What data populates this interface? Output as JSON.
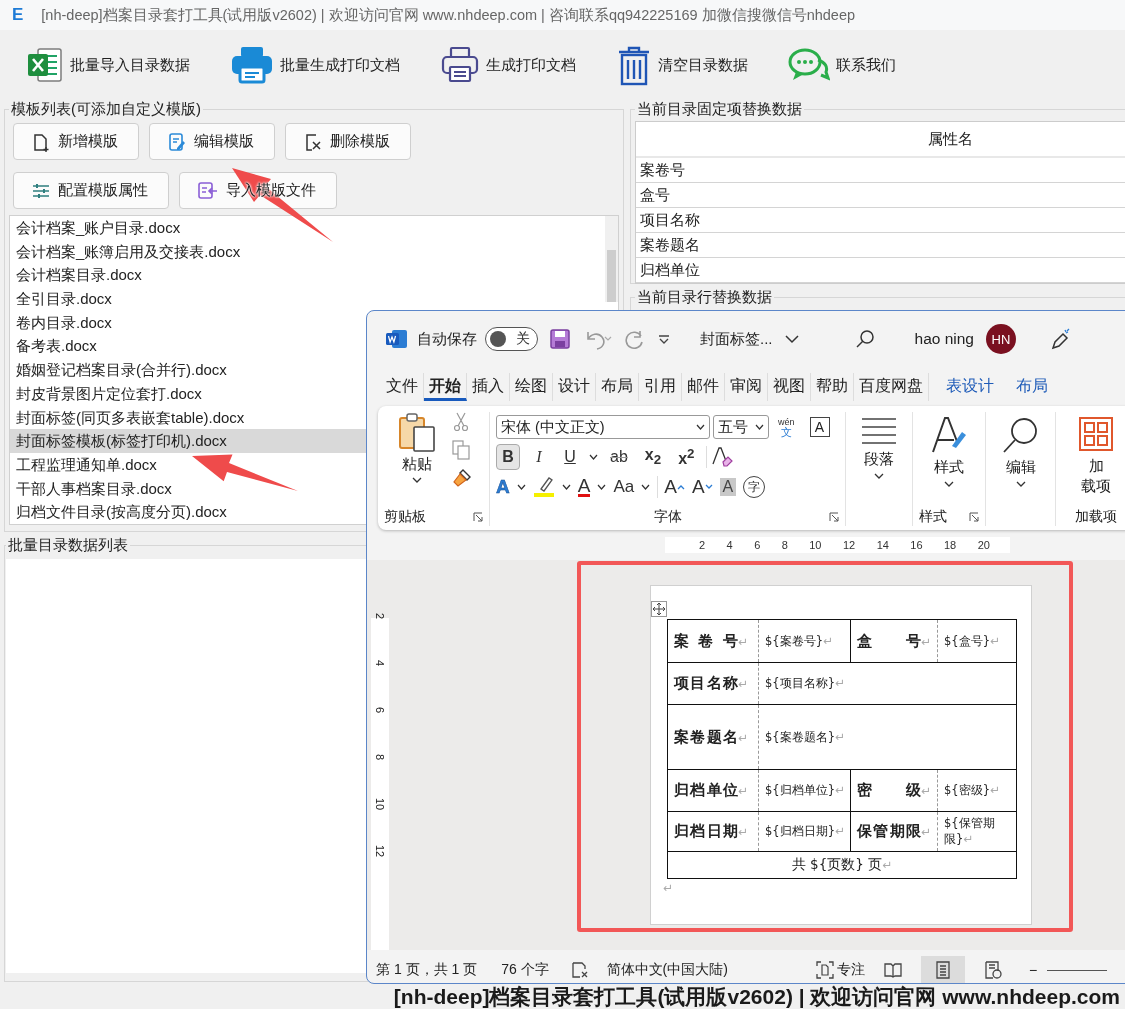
{
  "window": {
    "logo": "E",
    "title": "[nh-deep]档案目录套打工具(试用版v2602) | 欢迎访问官网 www.nhdeep.com | 咨询联系qq942225169 加微信搜微信号nhdeep"
  },
  "toolbar": [
    {
      "label": "批量导入目录数据"
    },
    {
      "label": "批量生成打印文档"
    },
    {
      "label": "生成打印文档"
    },
    {
      "label": "清空目录数据"
    },
    {
      "label": "联系我们"
    }
  ],
  "template_panel": {
    "title": "模板列表(可添加自定义模版)",
    "buttons": [
      {
        "label": "新增模版"
      },
      {
        "label": "编辑模版"
      },
      {
        "label": "删除模版"
      },
      {
        "label": "配置模版属性"
      },
      {
        "label": "导入模版文件"
      }
    ],
    "files": [
      {
        "name": "会计档案_账户目录.docx",
        "selected": false
      },
      {
        "name": "会计档案_账簿启用及交接表.docx",
        "selected": false
      },
      {
        "name": "会计档案目录.docx",
        "selected": false
      },
      {
        "name": "全引目录.docx",
        "selected": false
      },
      {
        "name": "卷内目录.docx",
        "selected": false
      },
      {
        "name": "备考表.docx",
        "selected": false
      },
      {
        "name": "婚姻登记档案目录(合并行).docx",
        "selected": false
      },
      {
        "name": "封皮背景图片定位套打.docx",
        "selected": false
      },
      {
        "name": "封面标签(同页多表嵌套table).docx",
        "selected": false
      },
      {
        "name": "封面标签模板(标签打印机).docx",
        "selected": true
      },
      {
        "name": "工程监理通知单.docx",
        "selected": false
      },
      {
        "name": "干部人事档案目录.docx",
        "selected": false
      },
      {
        "name": "归档文件目录(按高度分页).docx",
        "selected": false
      }
    ]
  },
  "batch_panel": {
    "title": "批量目录数据列表"
  },
  "fixed_panel": {
    "title": "当前目录固定项替换数据",
    "column": "属性名",
    "rows": [
      "案卷号",
      "盒号",
      "项目名称",
      "案卷题名",
      "归档单位"
    ]
  },
  "row_panel": {
    "title": "当前目录行替换数据"
  },
  "word": {
    "autosave": {
      "label": "自动保存",
      "on": false,
      "state_text": "关"
    },
    "doc_title": "封面标签...",
    "user": "hao ning",
    "avatar": "HN",
    "tabs": [
      {
        "label": "文件",
        "selected": false,
        "contextual": false
      },
      {
        "label": "开始",
        "selected": true,
        "contextual": false
      },
      {
        "label": "插入",
        "selected": false,
        "contextual": false
      },
      {
        "label": "绘图",
        "selected": false,
        "contextual": false
      },
      {
        "label": "设计",
        "selected": false,
        "contextual": false
      },
      {
        "label": "布局",
        "selected": false,
        "contextual": false
      },
      {
        "label": "引用",
        "selected": false,
        "contextual": false
      },
      {
        "label": "邮件",
        "selected": false,
        "contextual": false
      },
      {
        "label": "审阅",
        "selected": false,
        "contextual": false
      },
      {
        "label": "视图",
        "selected": false,
        "contextual": false
      },
      {
        "label": "帮助",
        "selected": false,
        "contextual": false
      },
      {
        "label": "百度网盘",
        "selected": false,
        "contextual": false
      },
      {
        "label": "表设计",
        "selected": false,
        "contextual": true
      },
      {
        "label": "布局",
        "selected": false,
        "contextual": true
      }
    ],
    "ribbon": {
      "paste": "粘贴",
      "font_name": "宋体 (中文正文)",
      "font_size": "五号",
      "phonetic": "wén",
      "phonetic_base": "文",
      "border_char": "A",
      "format": [
        {
          "kind": "bold",
          "label": "B",
          "selected": true
        },
        {
          "kind": "italic",
          "label": "I",
          "selected": false
        },
        {
          "kind": "underline",
          "label": "U",
          "selected": false
        },
        {
          "kind": "strike",
          "label": "ab",
          "selected": false
        },
        {
          "kind": "sub",
          "label": "x$_{2}$",
          "selected": false
        },
        {
          "kind": "sup",
          "label": "x$^{2}$",
          "selected": false
        }
      ],
      "effects": [
        {
          "kind": "effect",
          "label": "A"
        },
        {
          "kind": "highlight"
        },
        {
          "kind": "color",
          "label": "A"
        },
        {
          "kind": "case",
          "label": "Aa"
        },
        {
          "kind": "grow",
          "label": "A"
        },
        {
          "kind": "shrink",
          "label": "A"
        },
        {
          "kind": "shade",
          "label": "A"
        },
        {
          "kind": "enclose",
          "label": "字"
        }
      ],
      "clipboard_label": "剪贴板",
      "font_label": "字体",
      "paragraph": "段落",
      "styles": "样式",
      "styles_label": "样式",
      "editing": "编辑",
      "addins": [
        "加",
        "载项"
      ],
      "addins_label": "加载项"
    },
    "ruler": [
      "2",
      "4",
      "6",
      "8",
      "10",
      "12",
      "14",
      "16",
      "18",
      "20"
    ],
    "vruler": [
      "2",
      "4",
      "6",
      "8",
      "10",
      "12"
    ],
    "table": {
      "rows": [
        [
          {
            "kind": "label",
            "text": "案 卷 号",
            "mark": "↵"
          },
          {
            "kind": "value",
            "text": "${案卷号}",
            "mark": "↵"
          },
          {
            "kind": "label",
            "text": "盒 号",
            "mark": "↵"
          },
          {
            "kind": "value",
            "text": "${盒号}",
            "mark": "↵"
          }
        ],
        [
          {
            "kind": "label",
            "text": "项目名称",
            "mark": "↵"
          },
          {
            "kind": "value",
            "text": "${项目名称}",
            "mark": "↵",
            "colspan": 3
          }
        ],
        [
          {
            "kind": "label",
            "text": "案卷题名",
            "mark": "↵"
          },
          {
            "kind": "value",
            "text": "${案卷题名}",
            "mark": "↵",
            "colspan": 3
          }
        ],
        [
          {
            "kind": "label",
            "text": "归档单位",
            "mark": "↵"
          },
          {
            "kind": "value",
            "text": "${归档单位}",
            "mark": "↵"
          },
          {
            "kind": "label",
            "text": "密 级",
            "mark": "↵"
          },
          {
            "kind": "value",
            "text": "${密级}",
            "mark": "↵"
          }
        ],
        [
          {
            "kind": "label",
            "text": "归档日期",
            "mark": "↵"
          },
          {
            "kind": "value",
            "text": "${归档日期}",
            "mark": "↵"
          },
          {
            "kind": "label",
            "text": "保管期限",
            "mark": "↵"
          },
          {
            "kind": "value",
            "text": "${保管期限}",
            "mark": "↵"
          }
        ],
        [
          {
            "kind": "footer",
            "text": "共 ${页数} 页",
            "mark": "↵",
            "colspan": 4
          }
        ]
      ],
      "after_mark": "↵"
    },
    "status": {
      "page": "第 1 页，共 1 页",
      "words": "76 个字",
      "language": "简体中文(中国大陆)",
      "focus": "专注",
      "views": [
        {
          "selected": false
        },
        {
          "selected": true
        },
        {
          "selected": false
        }
      ],
      "zoom_out": "−"
    }
  },
  "caption": "[nh-deep]档案目录套打工具(试用版v2602) | 欢迎访问官网 www.nhdeep.com"
}
